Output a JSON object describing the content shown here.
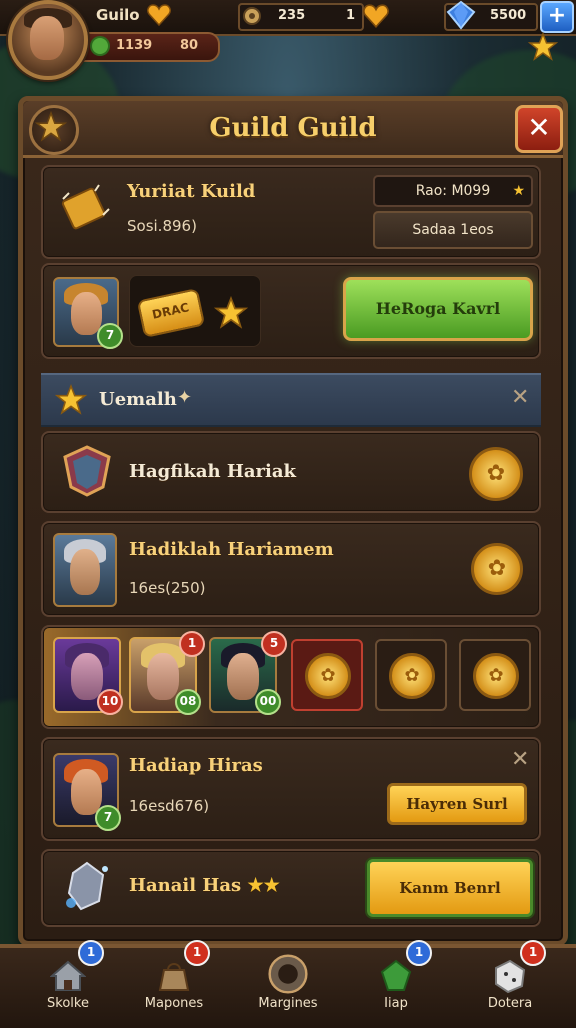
{
  "topbar": {
    "guild_label": "Guilo",
    "gold": "235",
    "count": "1",
    "gems": "5500",
    "plus": "+",
    "clover_value": "1139",
    "clover_extra": "80"
  },
  "panel": {
    "title": "Guild Guild",
    "close": "✕"
  },
  "guild_card": {
    "title": "Yuriiat Kuild",
    "subtitle": "Sosi.896)",
    "rank_pill": "Rao: M099",
    "action_pill": "Sadaa 1eos"
  },
  "hero_card": {
    "hero_level": "7",
    "ticket_label": "DRAC",
    "button": "HeRoga Kavrl"
  },
  "section": {
    "title": "Uemalh"
  },
  "rows": [
    {
      "title": "Hagfikah Hariak"
    },
    {
      "title": "Hadiklah Hariamem",
      "subtitle": "16es(250)"
    },
    {
      "levels": [
        "10",
        "08",
        "00"
      ],
      "badges": [
        "1",
        "5"
      ]
    },
    {
      "title": "Hadiap Hiras",
      "subtitle": "16esd676)",
      "level": "7",
      "button": "Hayren Surl"
    },
    {
      "title": "Hanail Has",
      "button": "Kanm Benrl"
    }
  ],
  "nav": [
    {
      "label": "Skolke",
      "badge": "1",
      "badge_color": "blue",
      "icon": "home-icon"
    },
    {
      "label": "Mapones",
      "badge": "1",
      "badge_color": "red",
      "icon": "bag-icon"
    },
    {
      "label": "Margines",
      "badge": "",
      "badge_color": "",
      "icon": "shield-icon"
    },
    {
      "label": "Iiap",
      "badge": "1",
      "badge_color": "blue",
      "icon": "gem-icon"
    },
    {
      "label": "Dotera",
      "badge": "1",
      "badge_color": "red",
      "icon": "dice-icon"
    }
  ],
  "colors": {
    "accent_gold": "#f7cf6a",
    "button_green": "#6fbf3a",
    "close_red": "#c0392b",
    "badge_blue": "#2f6bd8",
    "badge_red": "#d0301e"
  }
}
